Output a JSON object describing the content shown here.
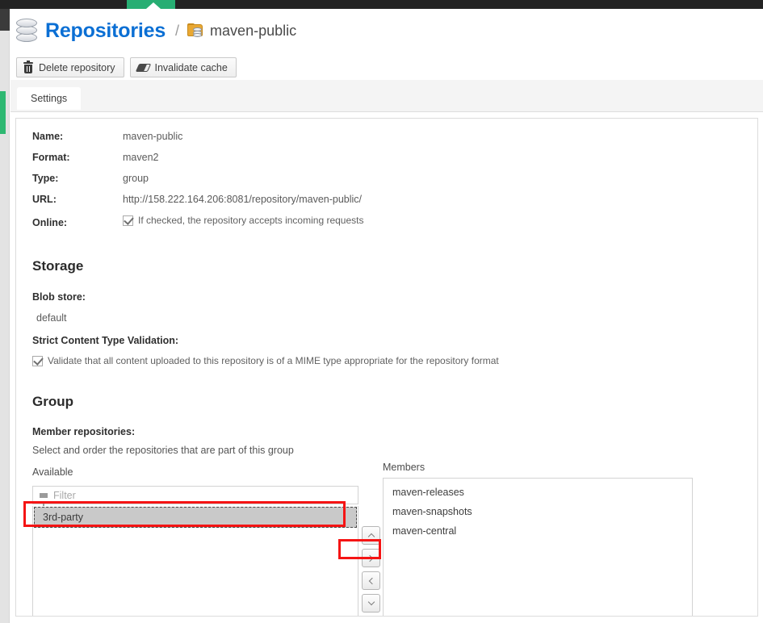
{
  "app": {
    "top_nav_active_item": "",
    "accent_green": "#27ae73",
    "title_blue": "#0b6fd4",
    "annotation_red": "#f51414"
  },
  "header": {
    "icon": "database-icon",
    "title": "Repositories",
    "separator": "/",
    "breadcrumb_icon": "repository-group-folder-icon",
    "breadcrumb_label": "maven-public"
  },
  "toolbar": {
    "buttons": [
      {
        "label": "Delete repository",
        "icon": "trash-icon"
      },
      {
        "label": "Invalidate cache",
        "icon": "eraser-icon"
      }
    ]
  },
  "tabs": [
    {
      "label": "Settings",
      "active": true
    }
  ],
  "details": {
    "fields": [
      {
        "label": "Name:",
        "value": "maven-public"
      },
      {
        "label": "Format:",
        "value": "maven2"
      },
      {
        "label": "Type:",
        "value": "group"
      },
      {
        "label": "URL:",
        "value": "http://158.222.164.206:8081/repository/maven-public/"
      }
    ],
    "online": {
      "label": "Online:",
      "checked": true,
      "text": "If checked, the repository accepts incoming requests"
    }
  },
  "storage": {
    "heading": "Storage",
    "blob_store_label": "Blob store:",
    "blob_store_value": "default",
    "strict_label": "Strict Content Type Validation:",
    "strict_checked": true,
    "strict_text": "Validate that all content uploaded to this repository is of a MIME type appropriate for the repository format"
  },
  "group": {
    "heading": "Group",
    "member_repos_label": "Member repositories:",
    "member_repos_help": "Select and order the repositories that are part of this group",
    "available_label": "Available",
    "members_label": "Members",
    "filter_placeholder": "Filter",
    "filter_value": "",
    "available_items": [
      {
        "label": "3rd-party",
        "selected": true
      }
    ],
    "member_items": [
      {
        "label": "maven-releases"
      },
      {
        "label": "maven-snapshots"
      },
      {
        "label": "maven-central"
      }
    ],
    "arrow_buttons": [
      {
        "name": "move-up-button",
        "icon": "chevron-up-icon"
      },
      {
        "name": "move-right-button",
        "icon": "chevron-right-icon"
      },
      {
        "name": "move-left-button",
        "icon": "chevron-left-icon"
      },
      {
        "name": "move-down-button",
        "icon": "chevron-down-icon"
      }
    ]
  },
  "annotations": [
    {
      "name": "available-item-highlight",
      "target": "3rd-party"
    },
    {
      "name": "move-right-highlight",
      "target": "move-right-button"
    }
  ]
}
